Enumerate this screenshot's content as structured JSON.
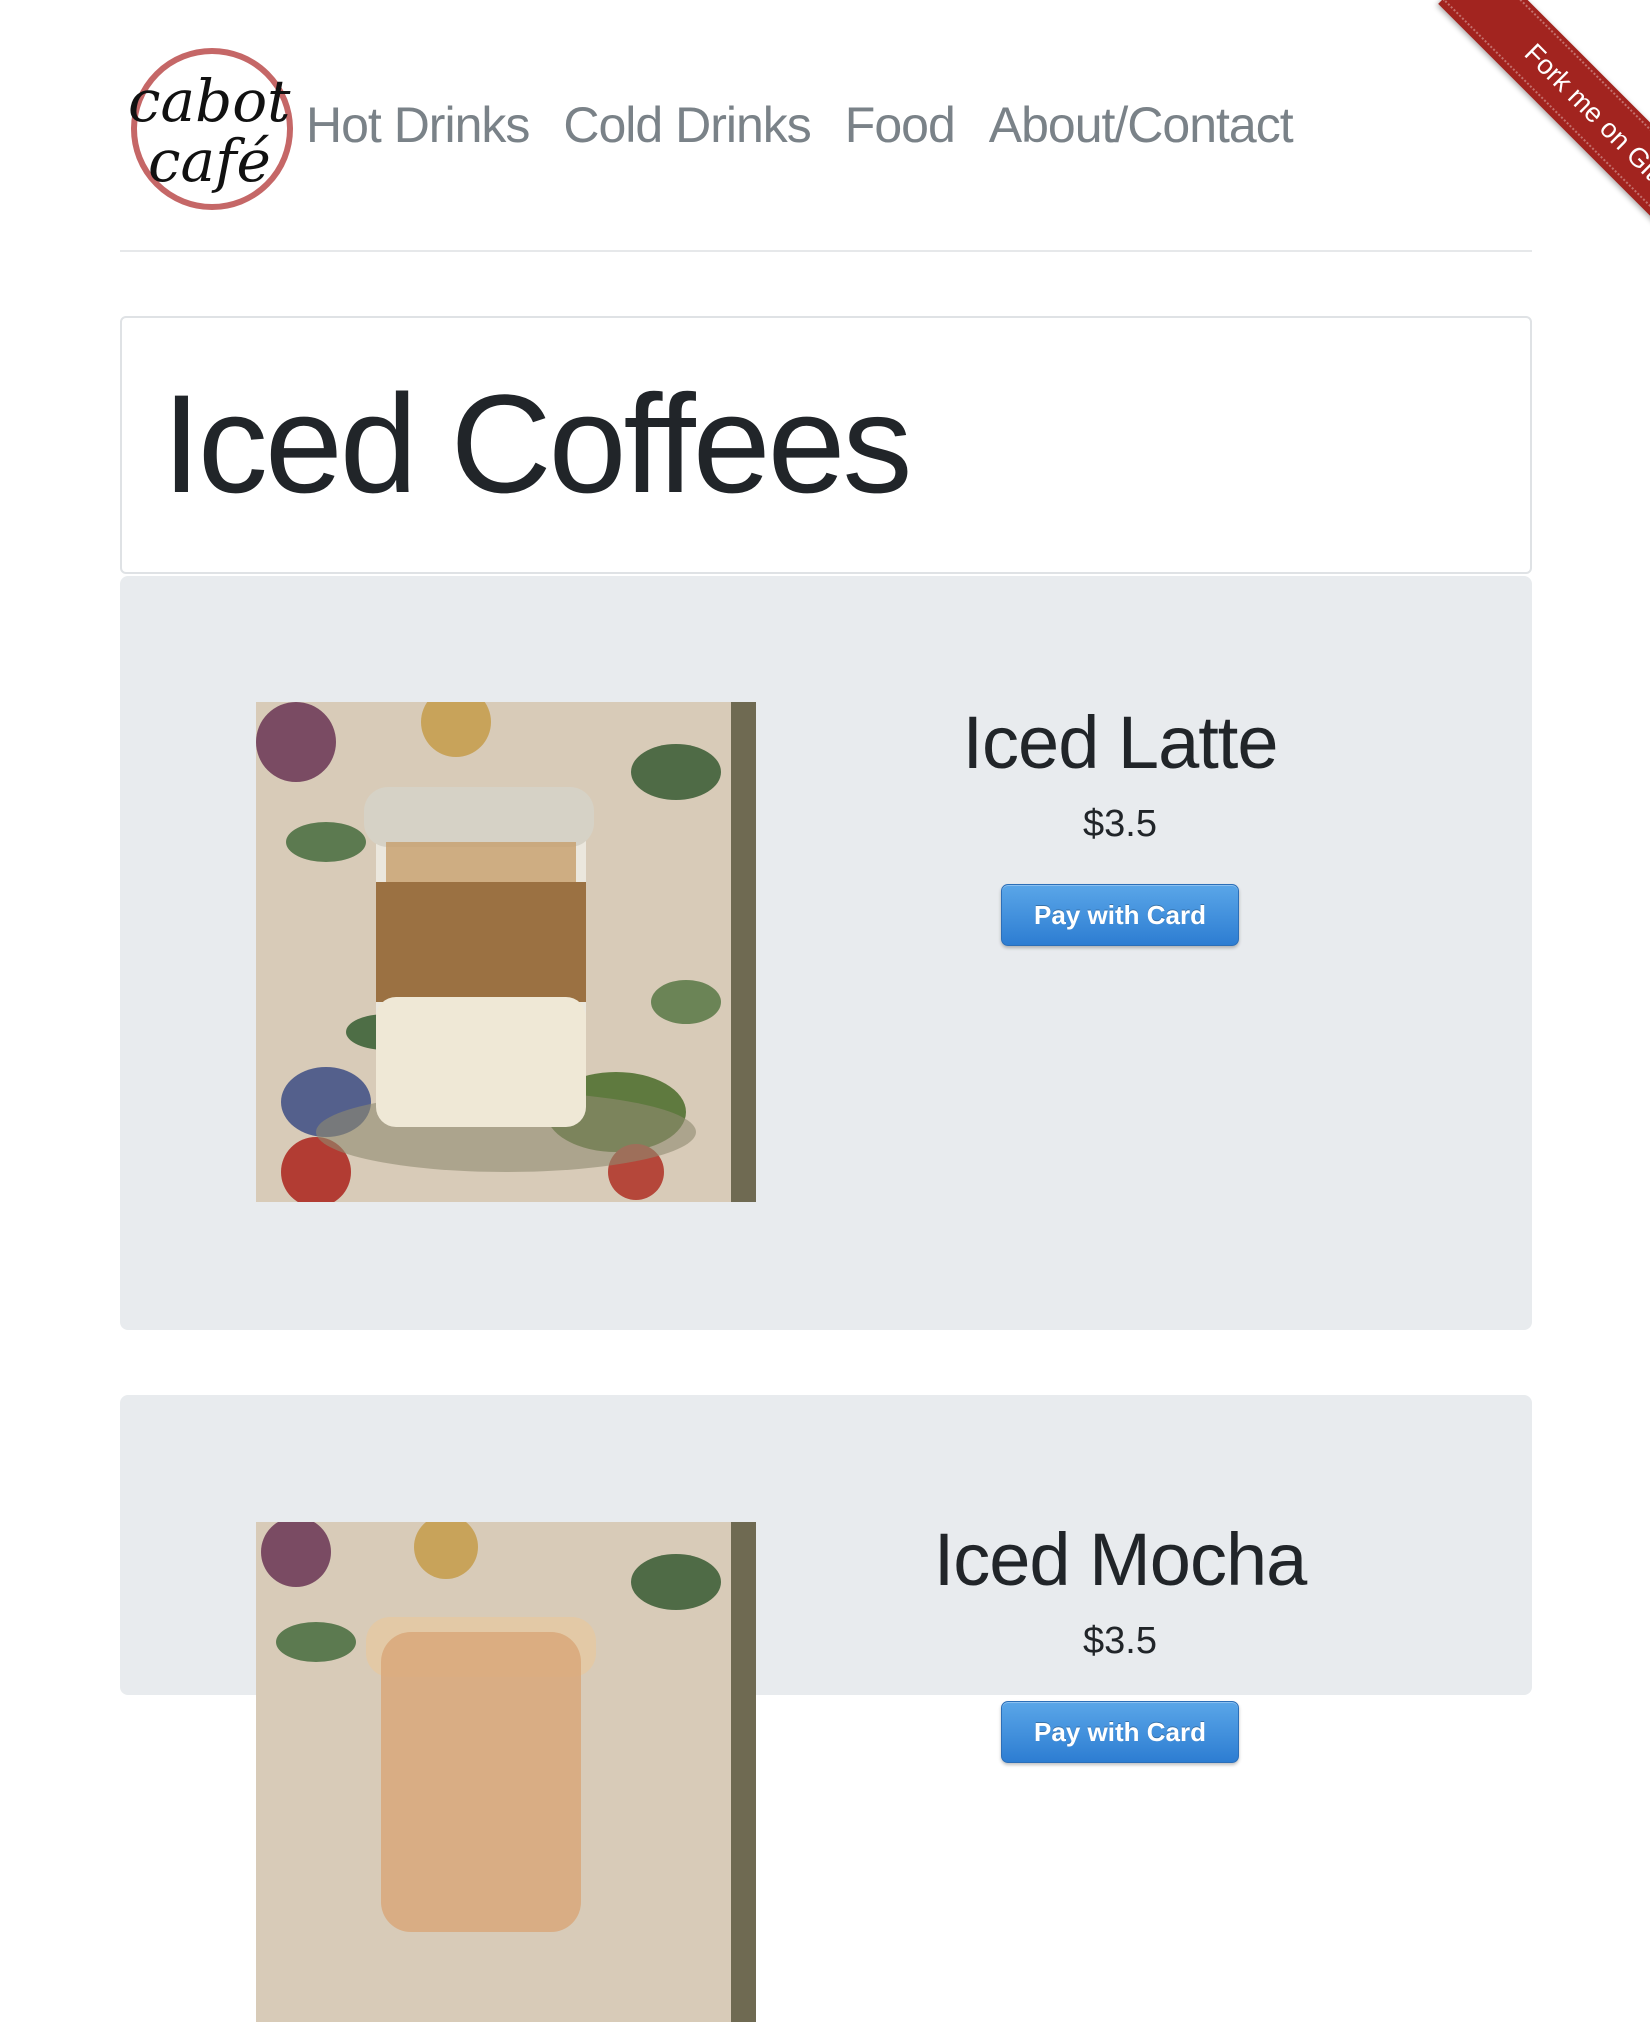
{
  "brand": {
    "logo_line1": "cabot",
    "logo_line2": "café"
  },
  "nav": {
    "items": [
      {
        "label": "Hot Drinks"
      },
      {
        "label": "Cold Drinks"
      },
      {
        "label": "Food"
      },
      {
        "label": "About/Contact"
      }
    ]
  },
  "ribbon": {
    "label": "Fork me on GitHub",
    "color": "#a2241f"
  },
  "page": {
    "title": "Iced Coffees"
  },
  "products": [
    {
      "name": "Iced Latte",
      "price": "$3.5",
      "button_label": "Pay with Card",
      "image": "iced-latte-photo"
    },
    {
      "name": "Iced Mocha",
      "price": "$3.5",
      "button_label": "Pay with Card",
      "image": "iced-mocha-photo"
    }
  ],
  "colors": {
    "nav_text": "#7a8288",
    "card_background": "#e8ebee",
    "button_blue": "#2d7dd2",
    "logo_ring": "#c56767"
  }
}
